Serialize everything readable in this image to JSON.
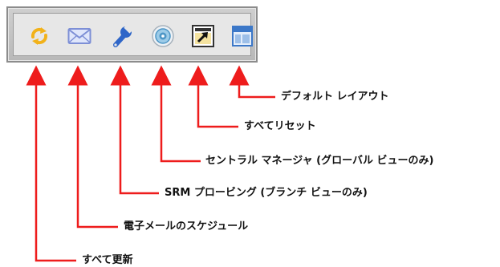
{
  "toolbar": {
    "buttons": [
      {
        "icon": "refresh-all-icon",
        "label": "すべて更新"
      },
      {
        "icon": "email-schedule-icon",
        "label": "電子メールのスケジュール"
      },
      {
        "icon": "wrench-icon",
        "label": "SRM プロービング (ブランチ ビューのみ)"
      },
      {
        "icon": "central-manager-icon",
        "label": "セントラル マネージャ (グローバル ビューのみ)"
      },
      {
        "icon": "reset-all-icon",
        "label": "すべてリセット"
      },
      {
        "icon": "default-layout-icon",
        "label": "デフォルト レイアウト"
      }
    ]
  },
  "colors": {
    "connector": "#ee1c1c",
    "refresh": "#f2b21a",
    "mail": "#7d8fd6",
    "wrench": "#2f66c8",
    "disc": "#4d96c6",
    "layout": "#3c78c8"
  }
}
